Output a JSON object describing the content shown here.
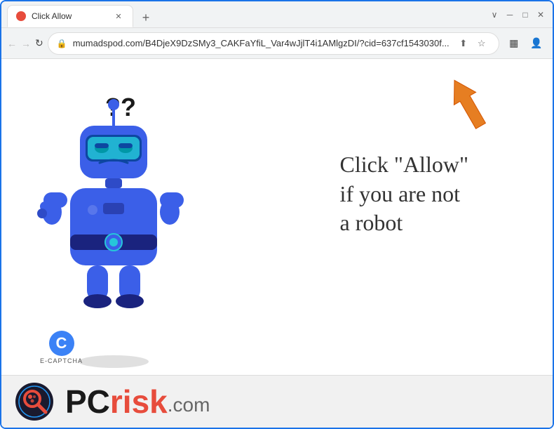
{
  "browser": {
    "tab": {
      "title": "Click Allow",
      "favicon_color": "#e74c3c"
    },
    "window_controls": {
      "minimize": "─",
      "maximize": "□",
      "close": "✕",
      "chevron_down": "∨"
    },
    "nav": {
      "back": "←",
      "forward": "→",
      "refresh": "↻"
    },
    "address_bar": {
      "url": "mumadspod.com/B4DjeX9DzSMy3_CAKFaYfiL_Var4wJjlT4i1AMlgzDI/?cid=637cf1543030f...",
      "lock_icon": "🔒"
    },
    "toolbar_icons": {
      "share": "⬆",
      "bookmark": "☆",
      "sidebar": "▦",
      "profile": "👤",
      "menu": "⋮"
    },
    "new_tab_icon": "+"
  },
  "page": {
    "caption_line1": "Click \"Allow\"",
    "caption_line2": "if you are not",
    "caption_line3": "a robot",
    "question_marks": "??",
    "ecaptcha_label": "E-CAPTCHA",
    "robot_color_primary": "#3b5fe8",
    "robot_color_dark": "#1a237e",
    "robot_color_visor": "#26c6da"
  },
  "watermark": {
    "pc_text": "PC",
    "risk_text": "risk",
    "dotcom": ".com"
  }
}
